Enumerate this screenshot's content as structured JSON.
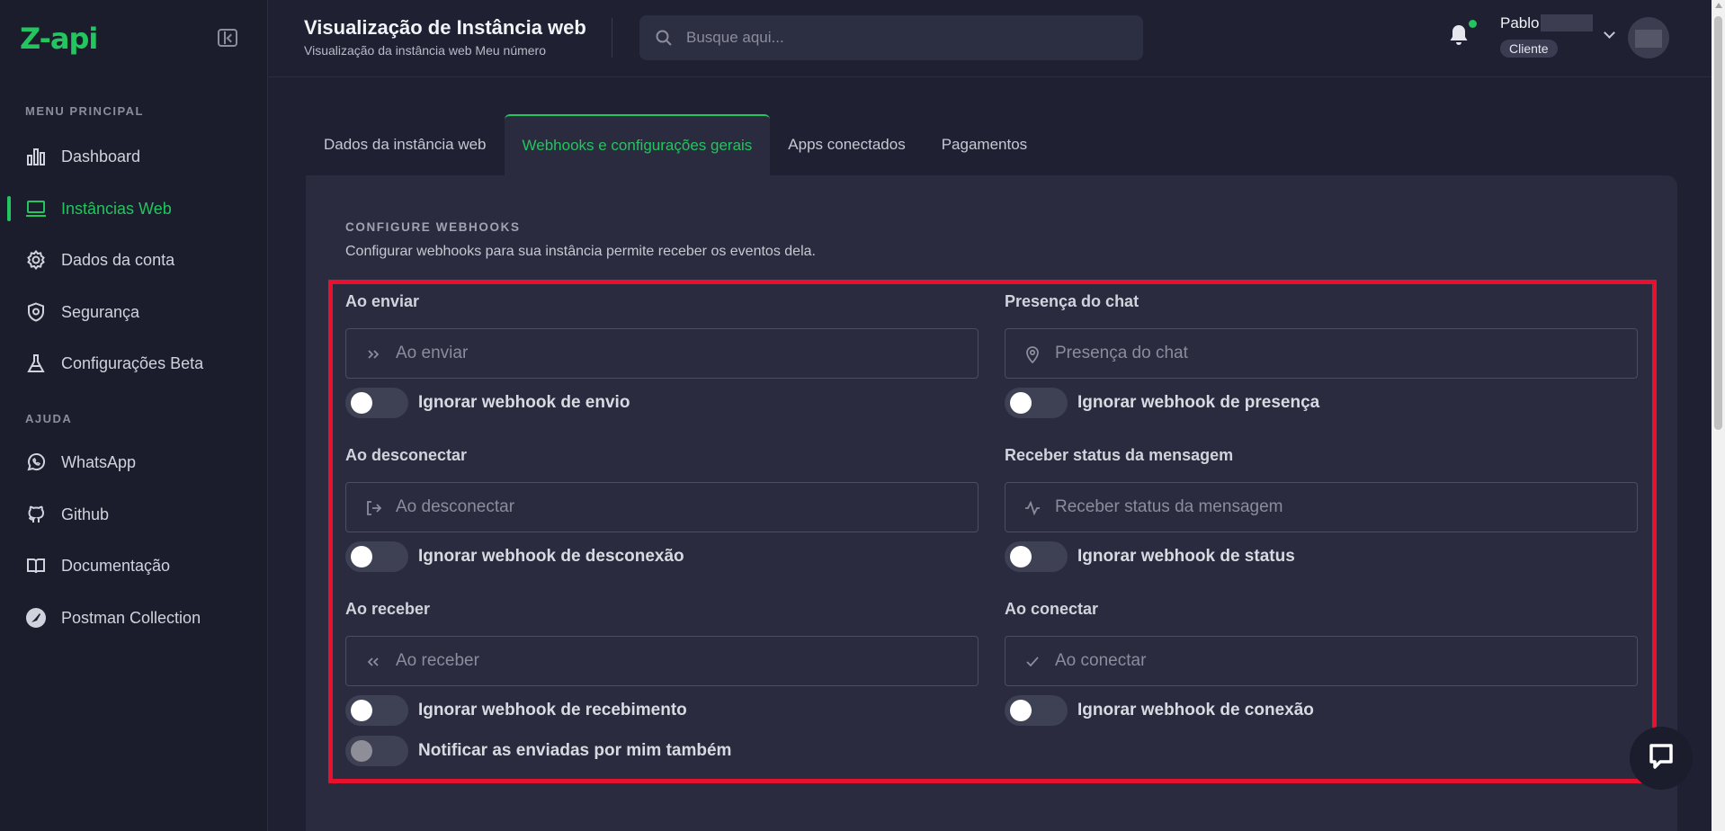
{
  "sidebar": {
    "logo": "Z-api",
    "sections": {
      "main": "MENU PRINCIPAL",
      "help": "AJUDA"
    },
    "items": [
      {
        "label": "Dashboard",
        "icon": "bar-chart-icon"
      },
      {
        "label": "Instâncias Web",
        "icon": "laptop-icon",
        "active": true
      },
      {
        "label": "Dados da conta",
        "icon": "gear-icon"
      },
      {
        "label": "Segurança",
        "icon": "shield-icon"
      },
      {
        "label": "Configurações Beta",
        "icon": "flask-icon"
      }
    ],
    "help_items": [
      {
        "label": "WhatsApp",
        "icon": "whatsapp-icon"
      },
      {
        "label": "Github",
        "icon": "github-icon"
      },
      {
        "label": "Documentação",
        "icon": "book-icon"
      },
      {
        "label": "Postman Collection",
        "icon": "postman-icon"
      }
    ]
  },
  "header": {
    "title": "Visualização de Instância web",
    "subtitle": "Visualização da instância web Meu número",
    "search_placeholder": "Busque aqui...",
    "user_name": "Pablo",
    "user_role": "Cliente"
  },
  "tabs": [
    {
      "label": "Dados da instância web"
    },
    {
      "label": "Webhooks e configurações gerais",
      "active": true
    },
    {
      "label": "Apps conectados"
    },
    {
      "label": "Pagamentos"
    }
  ],
  "config": {
    "title": "CONFIGURE WEBHOOKS",
    "description": "Configurar webhooks para sua instância permite receber os eventos dela.",
    "fields": {
      "on_send": {
        "label": "Ao enviar",
        "placeholder": "Ao enviar",
        "value": "",
        "toggle_label": "Ignorar webhook de envio",
        "toggle_on": false
      },
      "chat_presence": {
        "label": "Presença do chat",
        "placeholder": "Presença do chat",
        "value": "",
        "toggle_label": "Ignorar webhook de presença",
        "toggle_on": false
      },
      "on_disconnect": {
        "label": "Ao desconectar",
        "placeholder": "Ao desconectar",
        "value": "",
        "toggle_label": "Ignorar webhook de desconexão",
        "toggle_on": false
      },
      "message_status": {
        "label": "Receber status da mensagem",
        "placeholder": "Receber status da mensagem",
        "value": "",
        "toggle_label": "Ignorar webhook de status",
        "toggle_on": false
      },
      "on_receive": {
        "label": "Ao receber",
        "placeholder": "Ao receber",
        "value": "",
        "toggle_label": "Ignorar webhook de recebimento",
        "toggle_on": false
      },
      "on_connect": {
        "label": "Ao conectar",
        "placeholder": "Ao conectar",
        "value": "",
        "toggle_label": "Ignorar webhook de conexão",
        "toggle_on": false
      }
    },
    "notify_sent_by_me": {
      "label": "Notificar as enviadas por mim também",
      "toggle_on": false
    }
  },
  "colors": {
    "accent": "#22c55e",
    "highlight_border": "#e8112d",
    "background": "#1f2032",
    "panel": "#2a2b3e"
  }
}
